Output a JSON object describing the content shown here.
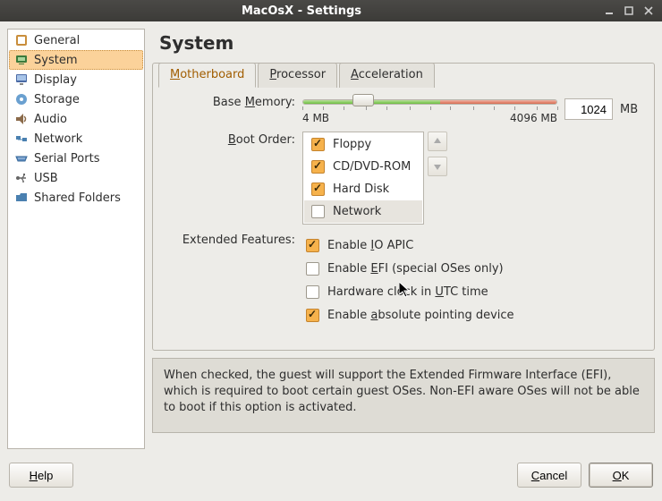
{
  "window": {
    "title": "MacOsX - Settings"
  },
  "sidebar": {
    "items": [
      {
        "label": "General"
      },
      {
        "label": "System"
      },
      {
        "label": "Display"
      },
      {
        "label": "Storage"
      },
      {
        "label": "Audio"
      },
      {
        "label": "Network"
      },
      {
        "label": "Serial Ports"
      },
      {
        "label": "USB"
      },
      {
        "label": "Shared Folders"
      }
    ],
    "selected_index": 1
  },
  "page": {
    "heading": "System",
    "tabs": [
      "Motherboard",
      "Processor",
      "Acceleration"
    ],
    "active_tab": 0,
    "base_memory": {
      "label_pre": "Base ",
      "label_u": "M",
      "label_post": "emory:",
      "value": "1024",
      "unit": "MB",
      "min_label": "4 MB",
      "max_label": "4096 MB"
    },
    "boot_order": {
      "label_u": "B",
      "label_post": "oot Order:",
      "items": [
        {
          "label": "Floppy",
          "checked": true
        },
        {
          "label": "CD/DVD-ROM",
          "checked": true
        },
        {
          "label": "Hard Disk",
          "checked": true
        },
        {
          "label": "Network",
          "checked": false
        }
      ],
      "selected_index": 3
    },
    "extended": {
      "label": "Extended Features:",
      "io_apic": {
        "pre": "Enable ",
        "u": "I",
        "post": "O APIC",
        "checked": true
      },
      "efi": {
        "pre": "Enable ",
        "u": "E",
        "post": "FI (special OSes only)",
        "checked": false
      },
      "utc": {
        "pre": "Hardware clock in ",
        "u": "U",
        "post": "TC time",
        "checked": false
      },
      "abs_ptr": {
        "pre": "Enable ",
        "u": "a",
        "post": "bsolute pointing device",
        "checked": true
      }
    }
  },
  "help_text": "When checked, the guest will support the Extended Firmware Interface (EFI), which is required to boot certain guest OSes. Non-EFI aware OSes will not be able to boot if this option is activated.",
  "footer": {
    "help_u": "H",
    "help_post": "elp",
    "cancel_u": "C",
    "cancel_post": "ancel",
    "ok_u": "O",
    "ok_post": "K"
  }
}
